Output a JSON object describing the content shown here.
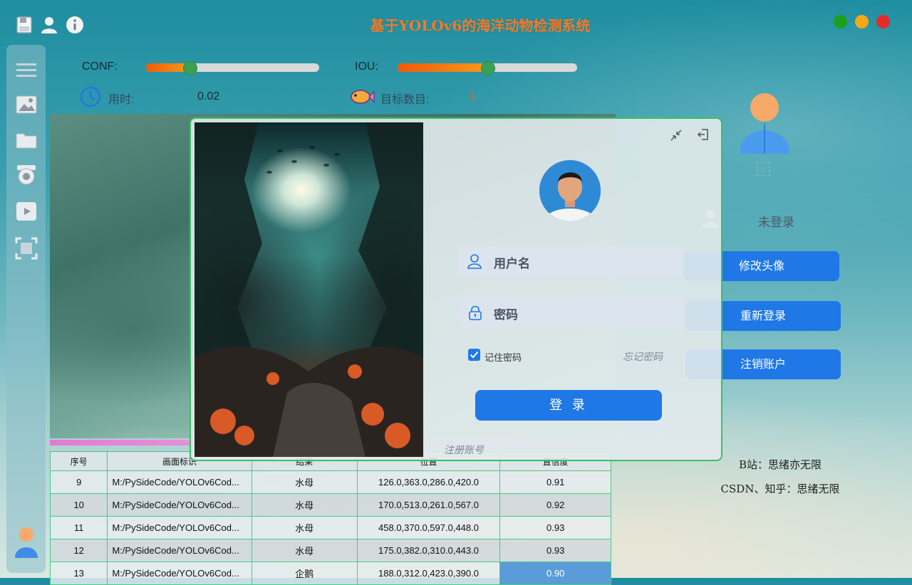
{
  "app": {
    "title": "基于YOLOv6的海洋动物检测系统",
    "window_controls": {
      "min_color": "#1aa01a",
      "max_color": "#f4a818",
      "close_color": "#e52a2a"
    }
  },
  "toolbar": {
    "icons": [
      "save-icon",
      "user-icon",
      "info-icon"
    ]
  },
  "sidebar": {
    "icons": [
      "menu-icon",
      "image-icon",
      "folder-icon",
      "camera-icon",
      "video-icon",
      "scan-icon",
      "avatar-icon"
    ]
  },
  "params": {
    "conf_label": "CONF:",
    "conf_value": 0.25,
    "iou_label": "IOU:",
    "iou_value": 0.5,
    "time_label": "用时:",
    "time_value": "0.02",
    "count_label": "目标数目:",
    "count_value": "1"
  },
  "table": {
    "headers": [
      "序号",
      "画面标识",
      "结果",
      "位置",
      "置信度"
    ],
    "rows": [
      {
        "id": "9",
        "path": "M:/PySideCode/YOLOv6Cod...",
        "result": "水母",
        "pos": "126.0,363.0,286.0,420.0",
        "conf": "0.91"
      },
      {
        "id": "10",
        "path": "M:/PySideCode/YOLOv6Cod...",
        "result": "水母",
        "pos": "170.0,513.0,261.0,567.0",
        "conf": "0.92"
      },
      {
        "id": "11",
        "path": "M:/PySideCode/YOLOv6Cod...",
        "result": "水母",
        "pos": "458.0,370.0,597.0,448.0",
        "conf": "0.93"
      },
      {
        "id": "12",
        "path": "M:/PySideCode/YOLOv6Cod...",
        "result": "水母",
        "pos": "175.0,382.0,310.0,443.0",
        "conf": "0.93"
      },
      {
        "id": "13",
        "path": "M:/PySideCode/YOLOv6Cod...",
        "result": "企鹅",
        "pos": "188.0,312.0,423.0,390.0",
        "conf": "0.90"
      }
    ]
  },
  "profile": {
    "status": "未登录",
    "add_label": "+",
    "change_avatar": "修改头像",
    "relogin": "重新登录",
    "logout": "注销账户",
    "credit1": "B站：思绪亦无限",
    "credit2": "CSDN、知乎：思绪无限"
  },
  "login": {
    "username_placeholder": "用户名",
    "password_placeholder": "密码",
    "remember_label": "记住密码",
    "remember_checked": true,
    "forgot": "忘记密码",
    "submit": "登 录",
    "register": "注册账号"
  }
}
